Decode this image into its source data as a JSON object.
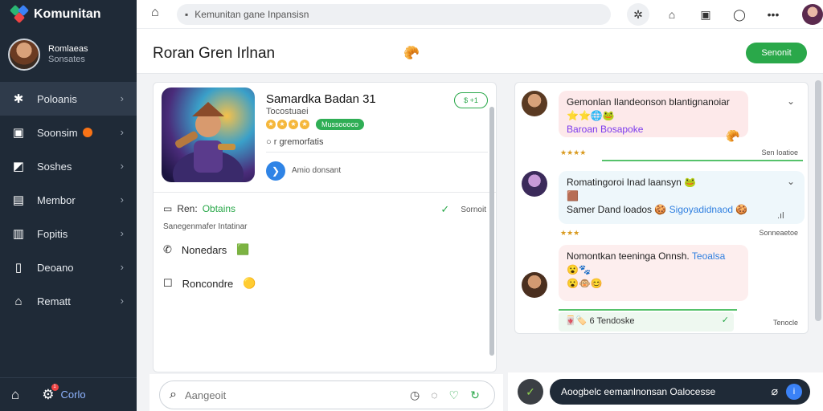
{
  "app": {
    "name": "Komunitan"
  },
  "user": {
    "name": "Romlaeas",
    "role": "Sonsates"
  },
  "sidebar": {
    "items": [
      {
        "label": "Poloanis",
        "icon": "puzzle-icon"
      },
      {
        "label": "Soonsim",
        "icon": "chat-icon"
      },
      {
        "label": "Soshes",
        "icon": "tag-icon"
      },
      {
        "label": "Membor",
        "icon": "monitor-icon"
      },
      {
        "label": "Fopitis",
        "icon": "book-icon"
      },
      {
        "label": "Deoano",
        "icon": "clipboard-icon"
      },
      {
        "label": "Rematt",
        "icon": "building-icon"
      }
    ],
    "bottom_label": "Corlo"
  },
  "topbar": {
    "address": "Kemunitan gane Inpansisn"
  },
  "header": {
    "title": "Roran Gren Irlnan",
    "action_label": "Senonit"
  },
  "game": {
    "name": "Samardka Badan 31",
    "subtitle": "Tocostuaei",
    "tag": "Mussoooco",
    "status": "$ +1",
    "genre": "r gremorfatis",
    "app_text": "Amio donsant"
  },
  "details": {
    "row_label": "Ren:",
    "row_value": "Obtains",
    "commit": "Sornoit",
    "desc": "Sanegenmafer Intatinar",
    "items": [
      "Nonedars",
      "Roncondre"
    ]
  },
  "composer_left": {
    "placeholder": "Aangeoit"
  },
  "messages": [
    {
      "text": "Gemonlan Ilandeonson blantignanoiar",
      "tag": "Baroan Bosapoke",
      "meta": "Sen Ioatioe"
    },
    {
      "text": "Romatingoroi Inad laansyn",
      "line2": "Samer Dand loados",
      "highlight": "Sigoyadidnaod",
      "meta": "Sonneaetoe"
    },
    {
      "text": "Nomontkan teeninga Onnsh.",
      "highlight": "Teoalsa",
      "meta": "Tonaelse"
    }
  ],
  "reply_bar": {
    "text": "Tendoske",
    "meta": "Tenocle"
  },
  "composer_right": {
    "text": "Aoogbelc eemanlnonsan Oalocesse"
  }
}
